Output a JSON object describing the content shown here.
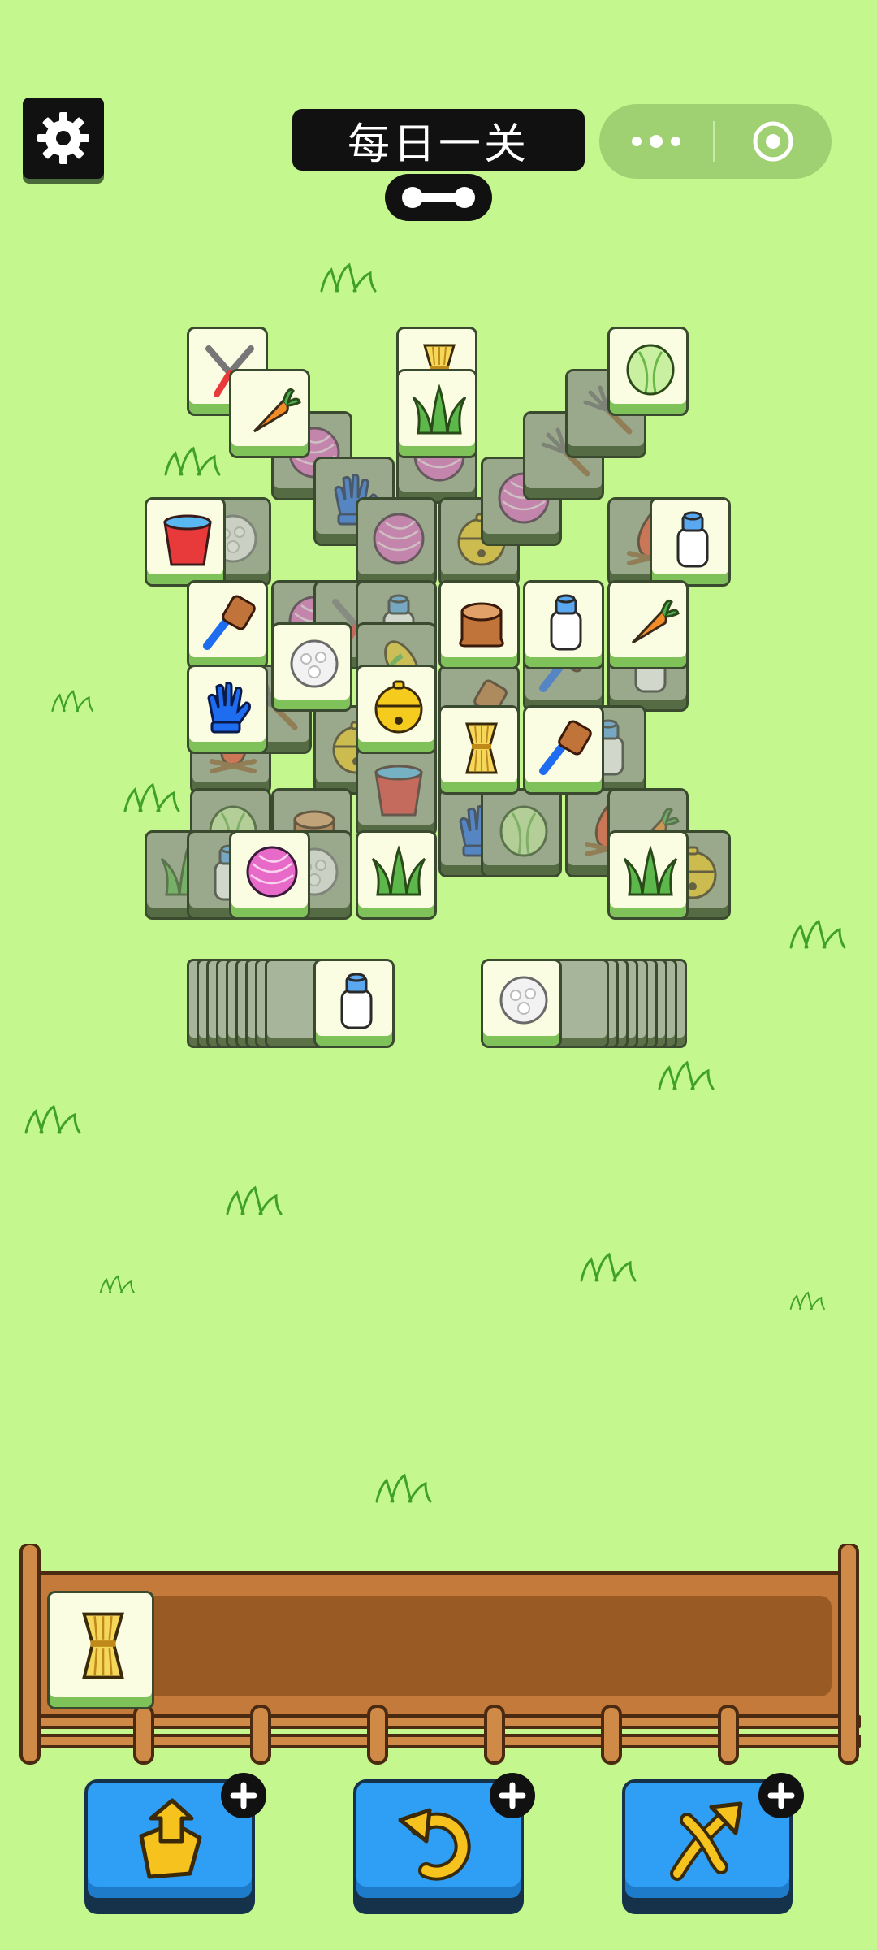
{
  "header": {
    "title": "每日一关",
    "settings_icon": "gear-icon",
    "menu_icon": "more-dots-icon",
    "close_icon": "target-close-icon"
  },
  "board": {
    "legend": {
      "carrot": "carrot",
      "grass": "grass",
      "cabbage": "cabbage",
      "yarn": "yarn-ball",
      "glove": "blue-glove",
      "bucket": "water-bucket",
      "milk": "milk-bottle",
      "brush": "brush",
      "stump": "tree-stump",
      "bell": "golden-bell",
      "wheat": "wheat-bundle",
      "cotton": "cotton-ball",
      "shears": "pruning-shears",
      "fork": "pitchfork",
      "fire": "campfire",
      "corn": "corn"
    },
    "front_tiles": [
      "shears",
      "carrot",
      "wheat",
      "grass",
      "cabbage",
      "fork",
      "bucket",
      "milk",
      "brush",
      "cotton",
      "stump",
      "milk",
      "carrot",
      "glove",
      "bell",
      "wheat",
      "brush",
      "yarn",
      "grass",
      "grass"
    ]
  },
  "deck": {
    "left_top": "milk",
    "right_top": "cotton"
  },
  "tray": {
    "slots": [
      "wheat"
    ]
  },
  "tools": [
    {
      "name": "remove",
      "icon": "box-arrow-up-icon"
    },
    {
      "name": "undo",
      "icon": "undo-icon"
    },
    {
      "name": "shuffle",
      "icon": "shuffle-icon"
    }
  ]
}
